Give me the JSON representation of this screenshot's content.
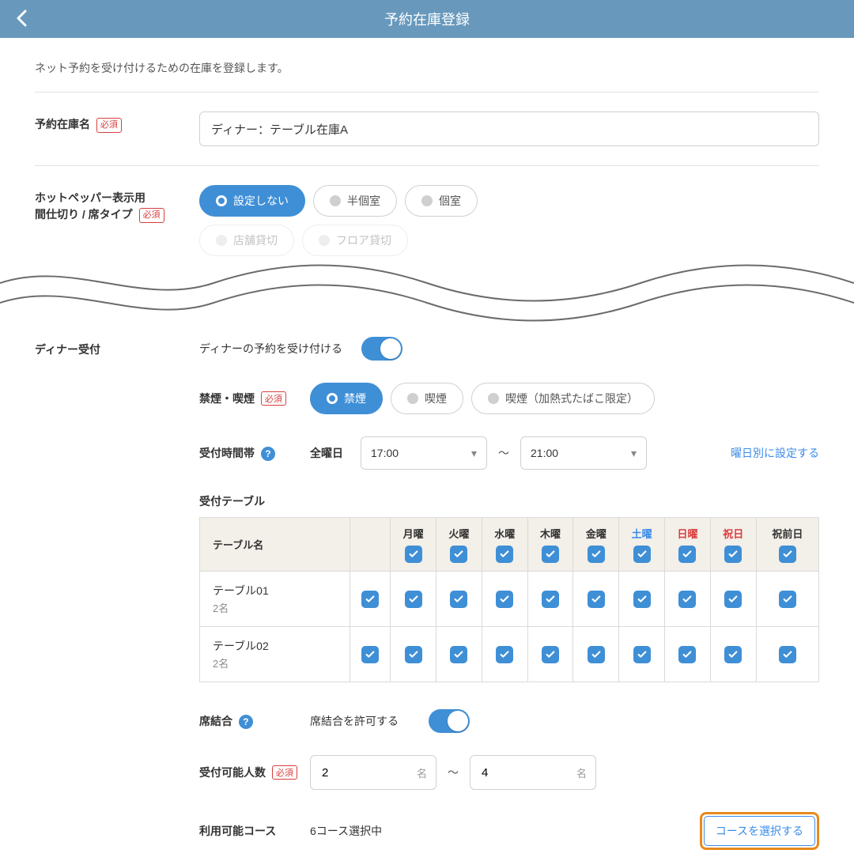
{
  "header": {
    "title": "予約在庫登録"
  },
  "intro": "ネット予約を受け付けるための在庫を登録します。",
  "badges": {
    "required": "必須"
  },
  "stock_name": {
    "label": "予約在庫名",
    "value": "ディナー：テーブル在庫A"
  },
  "seat_type": {
    "label": "ホットペッパー表示用\n間仕切り / 席タイプ",
    "options": [
      "設定しない",
      "半個室",
      "個室",
      "店舗貸切",
      "フロア貸切"
    ],
    "selected": 0
  },
  "dinner": {
    "section_label": "ディナー受付",
    "accept_label": "ディナーの予約を受け付ける",
    "smoking": {
      "label": "禁煙・喫煙",
      "options": [
        "禁煙",
        "喫煙",
        "喫煙（加熱式たばこ限定）"
      ],
      "selected": 0
    },
    "hours": {
      "label": "受付時間帯",
      "day_label": "全曜日",
      "start": "17:00",
      "end": "21:00",
      "tilde": "〜",
      "by_day_link": "曜日別に設定する"
    },
    "tables": {
      "title": "受付テーブル",
      "header_first": "テーブル名",
      "days": [
        "月曜",
        "火曜",
        "水曜",
        "木曜",
        "金曜",
        "土曜",
        "日曜",
        "祝日",
        "祝前日"
      ],
      "rows": [
        {
          "name": "テーブル01",
          "cap": "2名"
        },
        {
          "name": "テーブル02",
          "cap": "2名"
        }
      ]
    },
    "combine": {
      "label": "席結合",
      "text": "席結合を許可する"
    },
    "capacity": {
      "label": "受付可能人数",
      "min": "2",
      "max": "4",
      "unit": "名",
      "tilde": "〜"
    },
    "courses": {
      "label": "利用可能コース",
      "status": "6コース選択中",
      "button": "コースを選択する"
    }
  }
}
